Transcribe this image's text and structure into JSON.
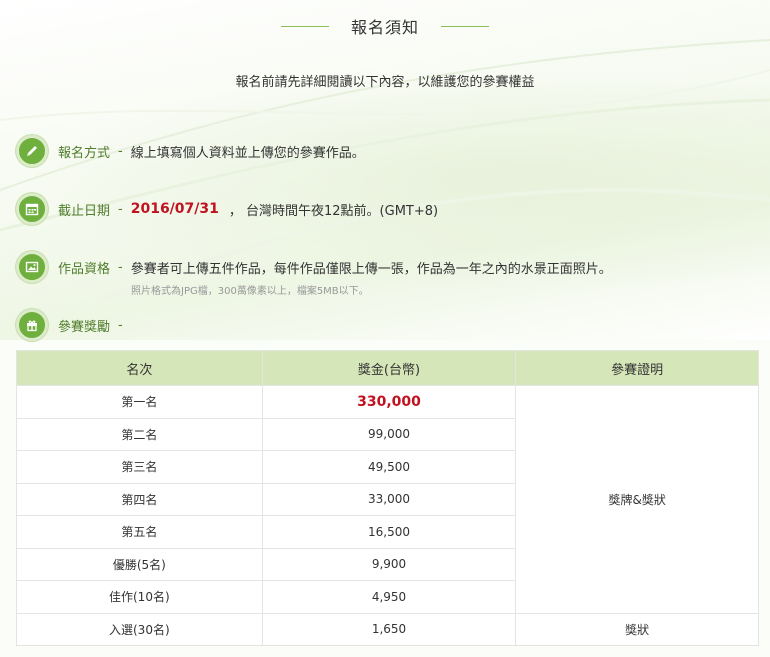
{
  "title": "報名須知",
  "subtitle": "報名前請先詳細閱讀以下內容，以維護您的參賽權益",
  "info": {
    "method": {
      "icon": "pencil-icon",
      "label": "報名方式",
      "dash": "-",
      "text": "線上填寫個人資料並上傳您的參賽作品。"
    },
    "deadline": {
      "icon": "calendar-icon",
      "label": "截止日期",
      "dash": "-",
      "date": "2016/07/31",
      "text": "， 台灣時間午夜12點前。(GMT+8)"
    },
    "eligibility": {
      "icon": "image-icon",
      "label": "作品資格",
      "dash": "-",
      "text": "參賽者可上傳五件作品，每件作品僅限上傳一張，作品為一年之內的水景正面照片。",
      "note": "照片格式為JPG檔，300萬像素以上，檔案5MB以下。"
    },
    "prizes": {
      "icon": "gift-icon",
      "label": "參賽獎勵",
      "dash": "-"
    }
  },
  "prize_table": {
    "headers": [
      "名次",
      "獎金(台幣)",
      "參賽證明"
    ],
    "rows": [
      {
        "rank": "第一名",
        "amount": "330,000"
      },
      {
        "rank": "第二名",
        "amount": "99,000"
      },
      {
        "rank": "第三名",
        "amount": "49,500"
      },
      {
        "rank": "第四名",
        "amount": "33,000"
      },
      {
        "rank": "第五名",
        "amount": "16,500"
      },
      {
        "rank": "優勝(5名)",
        "amount": "9,900"
      },
      {
        "rank": "佳作(10名)",
        "amount": "4,950"
      },
      {
        "rank": "入選(30名)",
        "amount": "1,650"
      }
    ],
    "proof_main": "獎牌&獎狀",
    "proof_last": "獎狀"
  },
  "colors": {
    "accent_green": "#6faf3e",
    "label_green": "#4f7d2b",
    "highlight_red": "#c0121f",
    "header_bg": "#d5e6b9"
  }
}
